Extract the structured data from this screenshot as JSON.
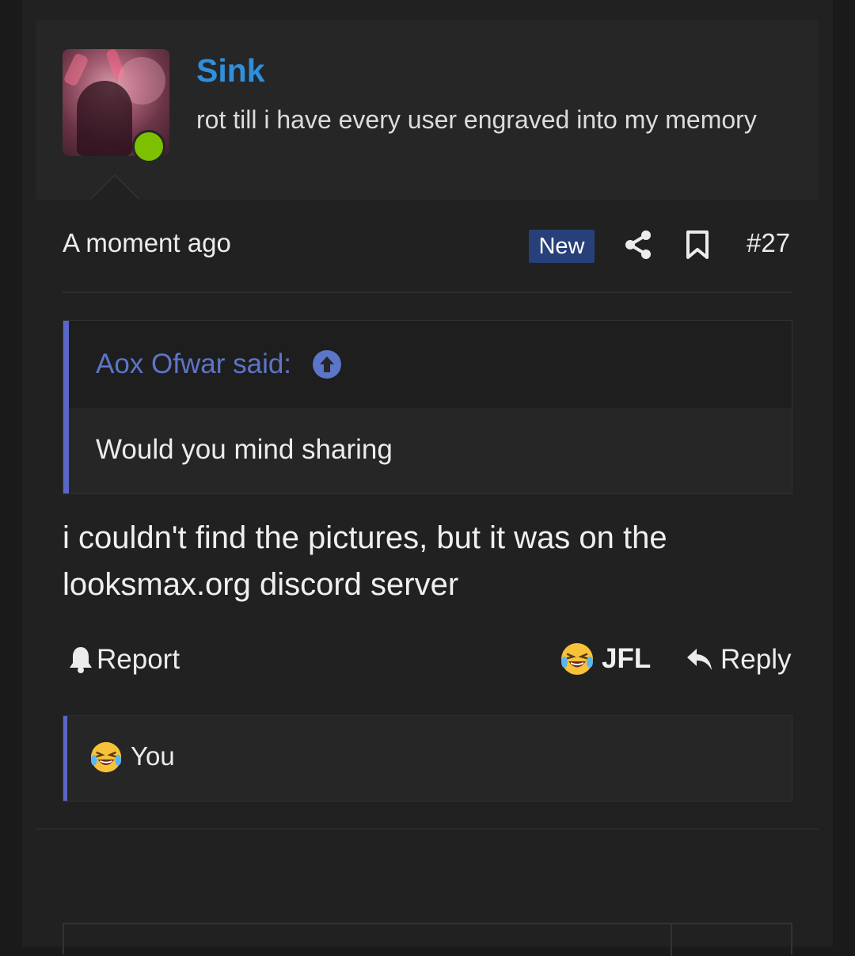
{
  "user": {
    "name": "Sink",
    "title": "rot till i have every user engraved into my memory",
    "online": true
  },
  "post": {
    "timestamp": "A moment ago",
    "new_badge": "New",
    "number": "#27",
    "quote": {
      "author": "Aox Ofwar said:",
      "text": "Would you mind sharing"
    },
    "body": "i couldn't find the pictures, but it was on the looksmax.org discord server"
  },
  "actions": {
    "report": "Report",
    "reaction": "JFL",
    "reply": "Reply"
  },
  "reactions": {
    "user": "You"
  },
  "colors": {
    "username": "#2f8fdd",
    "online": "#7cc000",
    "new_badge": "#27407a",
    "quote_accent": "#5a67c7"
  },
  "icons": [
    "share-icon",
    "bookmark-icon",
    "arrow-up-circle-icon",
    "bell-icon",
    "laughing-emoji-icon",
    "reply-arrow-icon"
  ]
}
